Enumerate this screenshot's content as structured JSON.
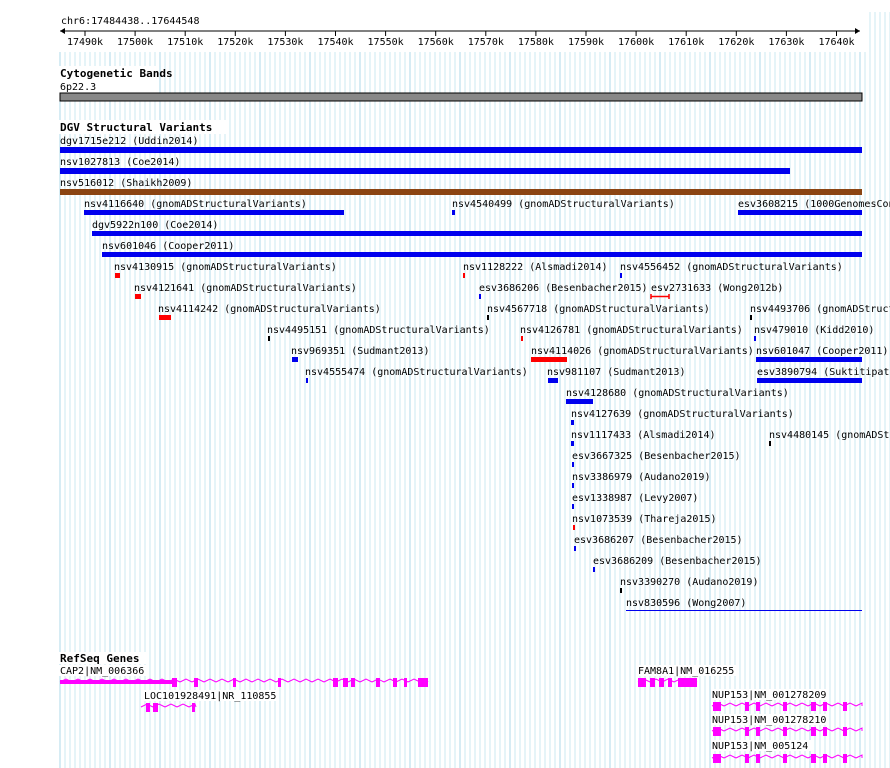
{
  "position_label": "chr6:17484438..17644548",
  "ruler_ticks": [
    "17490k",
    "17500k",
    "17510k",
    "17520k",
    "17530k",
    "17540k",
    "17550k",
    "17560k",
    "17570k",
    "17580k",
    "17590k",
    "17600k",
    "17610k",
    "17620k",
    "17630k",
    "17640k"
  ],
  "tracks": {
    "cytoband": {
      "title": "Cytogenetic Bands",
      "band_label": "6p22.3"
    },
    "dgv": {
      "title": "DGV Structural Variants"
    },
    "refseq": {
      "title": "RefSeq Genes"
    }
  },
  "colors": {
    "loss": "#ff0000",
    "gain": "#0000ee",
    "complex": "#000000",
    "other": "#8b4513",
    "gene": "#ff00ff",
    "band": "#888888",
    "grid": "#a8d8e8"
  },
  "dgv_variants": [
    {
      "id": "v1",
      "label": "dgv1715e212 (Uddin2014)",
      "type": "gain"
    },
    {
      "id": "v2",
      "label": "nsv1027813 (Coe2014)",
      "type": "gain"
    },
    {
      "id": "v3",
      "label": "nsv516012 (Shaikh2009)",
      "type": "other"
    },
    {
      "id": "v4",
      "label": "nsv4116640 (gnomADStructuralVariants)",
      "type": "gain"
    },
    {
      "id": "v5",
      "label": "nsv4540499 (gnomADStructuralVariants)",
      "type": "gain"
    },
    {
      "id": "v6",
      "label": "esv3608215 (1000GenomesCon",
      "type": "gain"
    },
    {
      "id": "v7",
      "label": "dgv5922n100 (Coe2014)",
      "type": "gain"
    },
    {
      "id": "v8",
      "label": "nsv601046 (Cooper2011)",
      "type": "gain"
    },
    {
      "id": "v9",
      "label": "nsv4130915 (gnomADStructuralVariants)",
      "type": "loss"
    },
    {
      "id": "v10",
      "label": "nsv1128222 (Alsmadi2014)",
      "type": "loss"
    },
    {
      "id": "v11",
      "label": "nsv4556452 (gnomADStructuralVariants)",
      "type": "gain"
    },
    {
      "id": "v12",
      "label": "nsv4121641 (gnomADStructuralVariants)",
      "type": "loss"
    },
    {
      "id": "v13",
      "label": "esv3686206 (Besenbacher2015)",
      "type": "gain"
    },
    {
      "id": "v14",
      "label": "esv2731633 (Wong2012b)",
      "type": "loss"
    },
    {
      "id": "v15",
      "label": "nsv4114242 (gnomADStructuralVariants)",
      "type": "loss"
    },
    {
      "id": "v16",
      "label": "nsv4567718 (gnomADStructuralVariants)",
      "type": "complex"
    },
    {
      "id": "v17",
      "label": "nsv4493706 (gnomADStruct",
      "type": "complex"
    },
    {
      "id": "v18",
      "label": "nsv4495151 (gnomADStructuralVariants)",
      "type": "complex"
    },
    {
      "id": "v19",
      "label": "nsv4126781 (gnomADStructuralVariants)",
      "type": "loss"
    },
    {
      "id": "v20",
      "label": "nsv479010 (Kidd2010)",
      "type": "gain"
    },
    {
      "id": "v21",
      "label": "nsv969351 (Sudmant2013)",
      "type": "gain"
    },
    {
      "id": "v22",
      "label": "nsv4114026 (gnomADStructuralVariants)",
      "type": "loss"
    },
    {
      "id": "v23",
      "label": "nsv601047 (Cooper2011)",
      "type": "gain"
    },
    {
      "id": "v24",
      "label": "nsv4555474 (gnomADStructuralVariants)",
      "type": "gain"
    },
    {
      "id": "v25",
      "label": "nsv981107 (Sudmant2013)",
      "type": "gain"
    },
    {
      "id": "v26",
      "label": "esv3890794 (Suktitipat2",
      "type": "gain"
    },
    {
      "id": "v27",
      "label": "nsv4128680 (gnomADStructuralVariants)",
      "type": "gain"
    },
    {
      "id": "v28",
      "label": "nsv4127639 (gnomADStructuralVariants)",
      "type": "gain"
    },
    {
      "id": "v29",
      "label": "nsv1117433 (Alsmadi2014)",
      "type": "gain"
    },
    {
      "id": "v30",
      "label": "nsv4480145 (gnomADStr",
      "type": "complex"
    },
    {
      "id": "v31",
      "label": "esv3667325 (Besenbacher2015)",
      "type": "gain"
    },
    {
      "id": "v32",
      "label": "nsv3386979 (Audano2019)",
      "type": "gain"
    },
    {
      "id": "v33",
      "label": "esv1338987 (Levy2007)",
      "type": "gain"
    },
    {
      "id": "v34",
      "label": "nsv1073539 (Thareja2015)",
      "type": "loss"
    },
    {
      "id": "v35",
      "label": "esv3686207 (Besenbacher2015)",
      "type": "gain"
    },
    {
      "id": "v36",
      "label": "esv3686209 (Besenbacher2015)",
      "type": "gain"
    },
    {
      "id": "v37",
      "label": "nsv3390270 (Audano2019)",
      "type": "complex"
    },
    {
      "id": "v38",
      "label": "nsv830596 (Wong2007)",
      "type": "gain"
    }
  ],
  "genes": [
    {
      "id": "g1",
      "label": "CAP2|NM_006366"
    },
    {
      "id": "g2",
      "label": "FAM8A1|NM_016255"
    },
    {
      "id": "g3",
      "label": "LOC101928491|NR_110855"
    },
    {
      "id": "g4",
      "label": "NUP153|NM_001278209"
    },
    {
      "id": "g5",
      "label": "NUP153|NM_001278210"
    },
    {
      "id": "g6",
      "label": "NUP153|NM_005124"
    }
  ]
}
